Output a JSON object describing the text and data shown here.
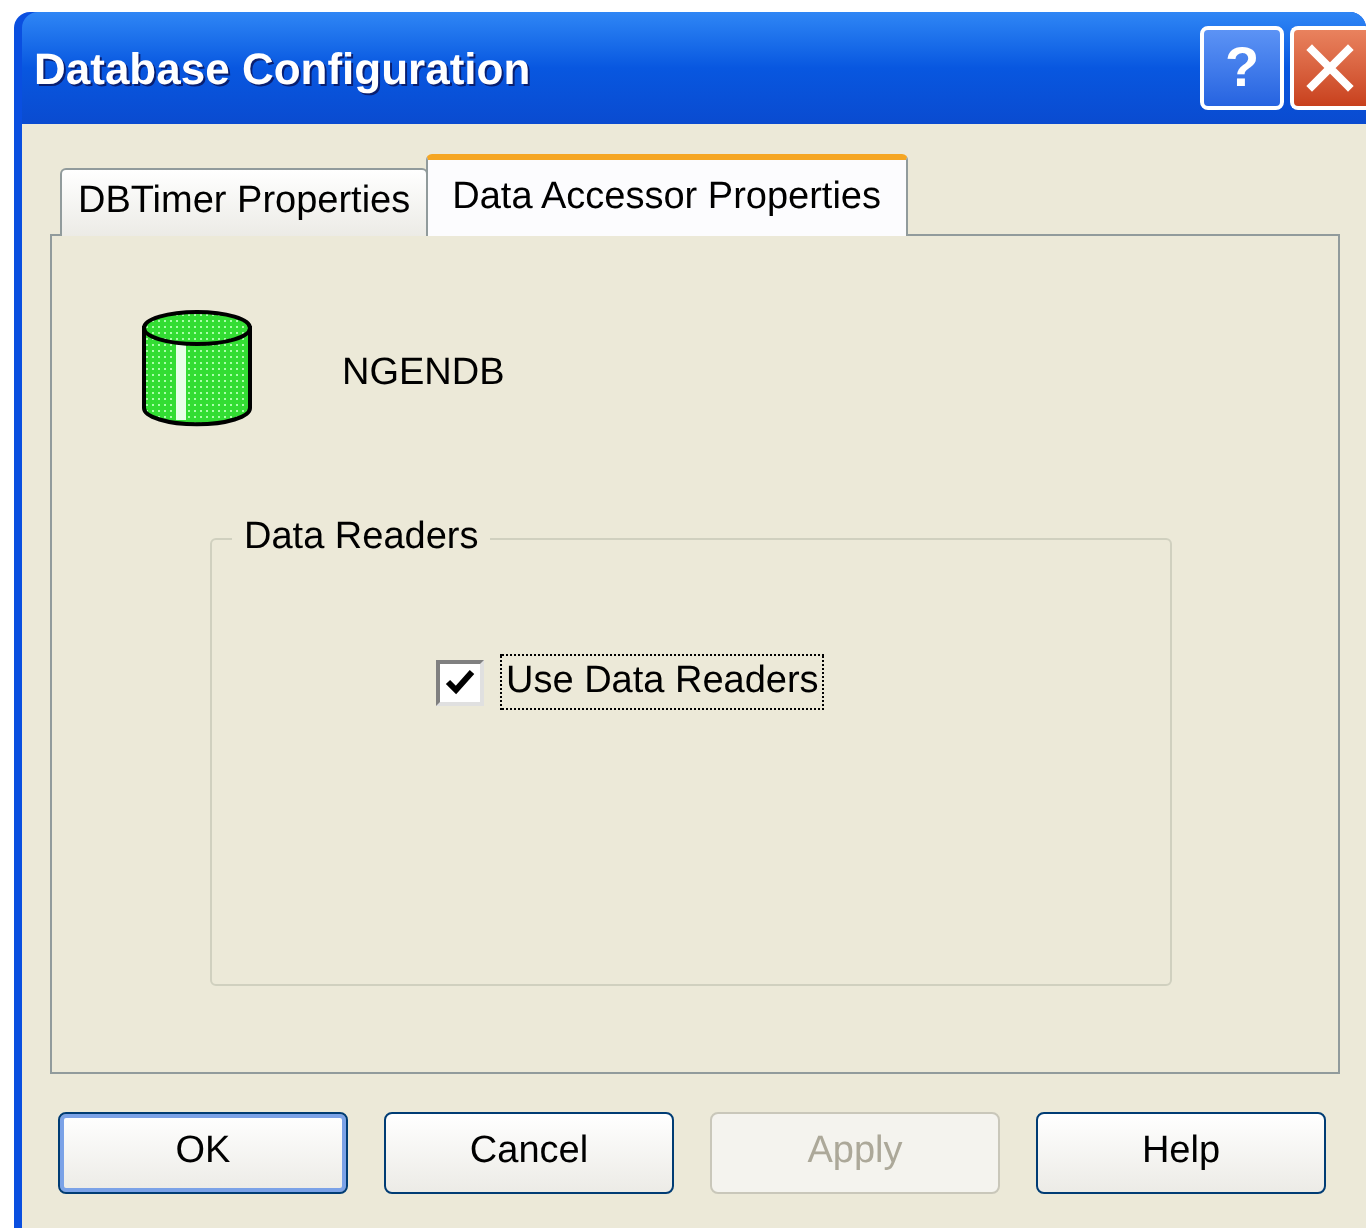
{
  "window": {
    "title": "Database Configuration"
  },
  "title_buttons": [
    {
      "kind": "help",
      "label": "?"
    },
    {
      "kind": "close"
    }
  ],
  "tabs": [
    {
      "label": "DBTimer Properties",
      "selected": false
    },
    {
      "label": "Data Accessor Properties",
      "selected": true
    }
  ],
  "database": {
    "name": "NGENDB"
  },
  "group": {
    "title": "Data Readers",
    "checkbox": {
      "label": "Use Data Readers",
      "checked": true,
      "focused": true
    }
  },
  "buttons": [
    {
      "label": "OK",
      "default": true,
      "disabled": false
    },
    {
      "label": "Cancel",
      "default": false,
      "disabled": false
    },
    {
      "label": "Apply",
      "default": false,
      "disabled": true
    },
    {
      "label": "Help",
      "default": false,
      "disabled": false
    }
  ]
}
